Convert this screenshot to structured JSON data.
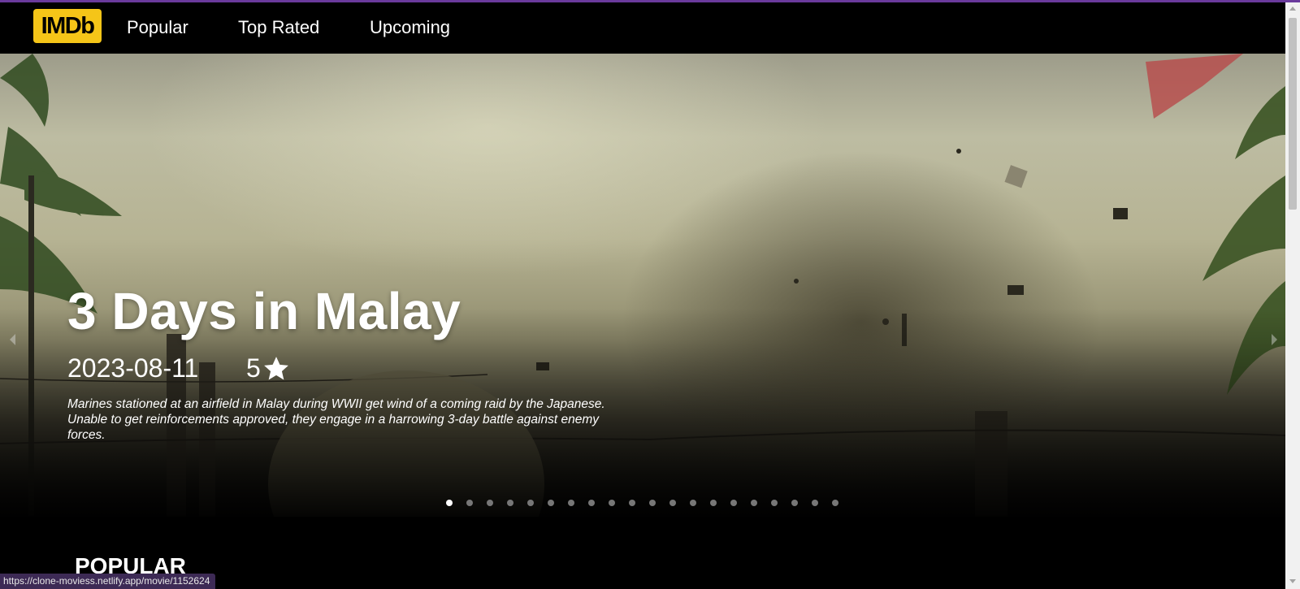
{
  "header": {
    "logo_text": "IMDb",
    "logo_color": "#f5c518",
    "nav": [
      {
        "label": "Popular"
      },
      {
        "label": "Top Rated"
      },
      {
        "label": "Upcoming"
      }
    ]
  },
  "hero": {
    "title": "3 Days in Malay",
    "release_date": "2023-08-11",
    "rating": "5",
    "rating_icon": "star-icon",
    "overview": "Marines stationed at an airfield in Malay during WWII get wind of a coming raid by the Japanese. Unable to get reinforcements approved, they engage in a harrowing 3-day battle against enemy forces.",
    "slide_count": 20,
    "active_slide": 1
  },
  "section": {
    "title": "POPULAR"
  },
  "status_bar": {
    "url": "https://clone-moviess.netlify.app/movie/1152624"
  },
  "colors": {
    "accent": "#6a3a9c",
    "background": "#000000"
  }
}
